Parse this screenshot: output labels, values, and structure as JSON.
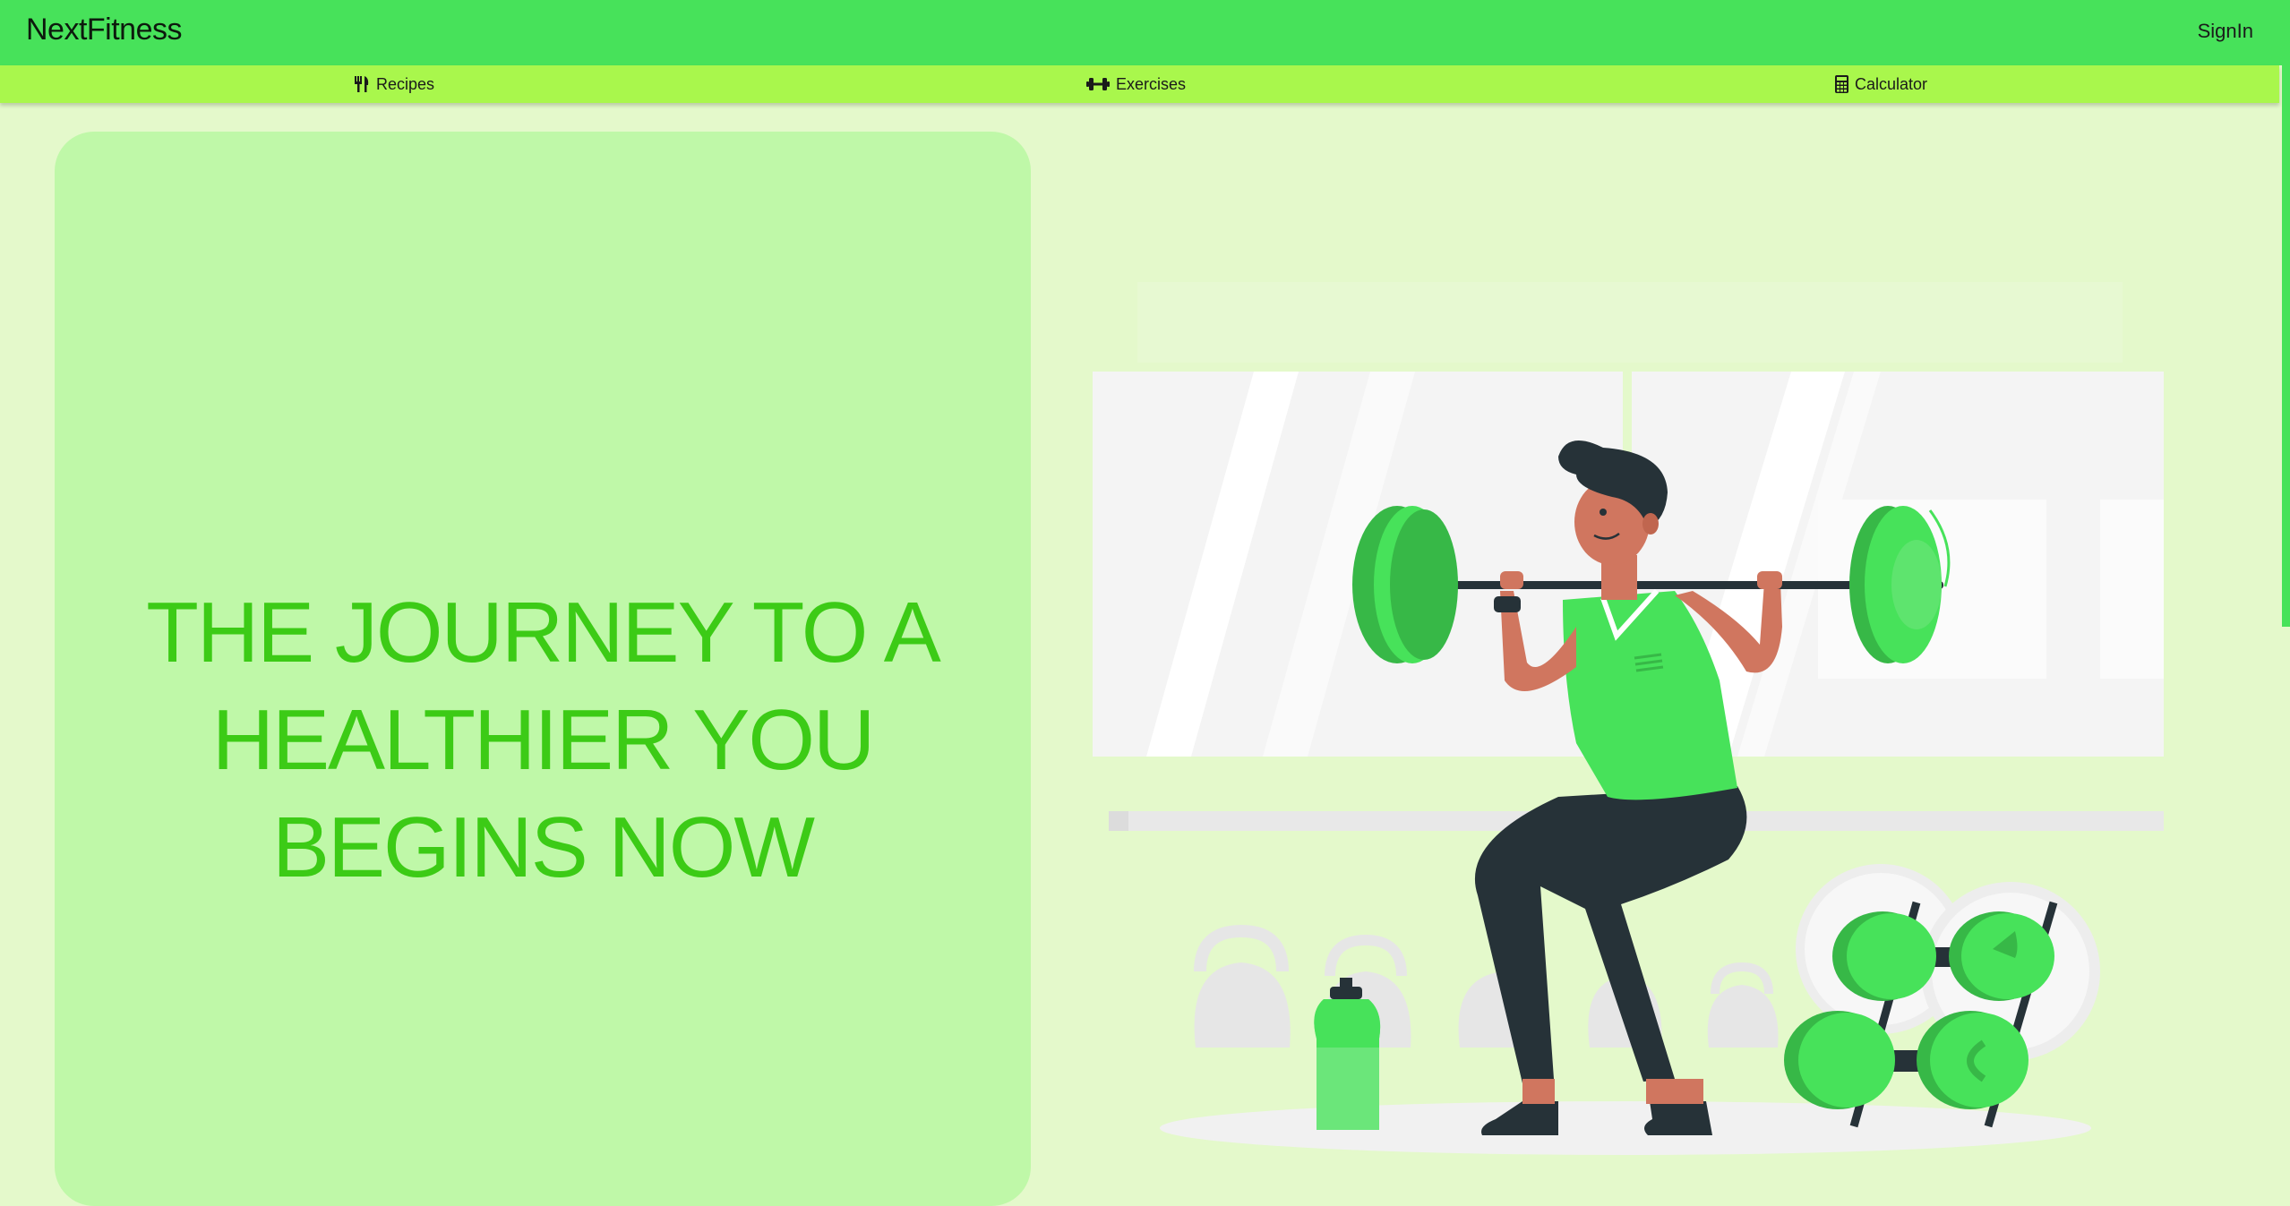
{
  "header": {
    "brand": "NextFitness",
    "signin_label": "SignIn",
    "background_color": "#47e25a"
  },
  "nav": {
    "background_color": "#a9f74c",
    "items": [
      {
        "label": "Recipes",
        "icon": "utensils-icon"
      },
      {
        "label": "Exercises",
        "icon": "dumbbell-icon"
      },
      {
        "label": "Calculator",
        "icon": "calculator-icon"
      }
    ]
  },
  "hero": {
    "headline_lines": [
      "THE JOURNEY TO A",
      "HEALTHIER YOU",
      "BEGINS NOW"
    ],
    "headline_color": "#3ccb16",
    "card_color": "#bff8a8",
    "illustration": "man-squatting-with-barbell-illustration"
  },
  "colors": {
    "page_background": "#e4f9cb",
    "accent_green": "#47e25a"
  }
}
